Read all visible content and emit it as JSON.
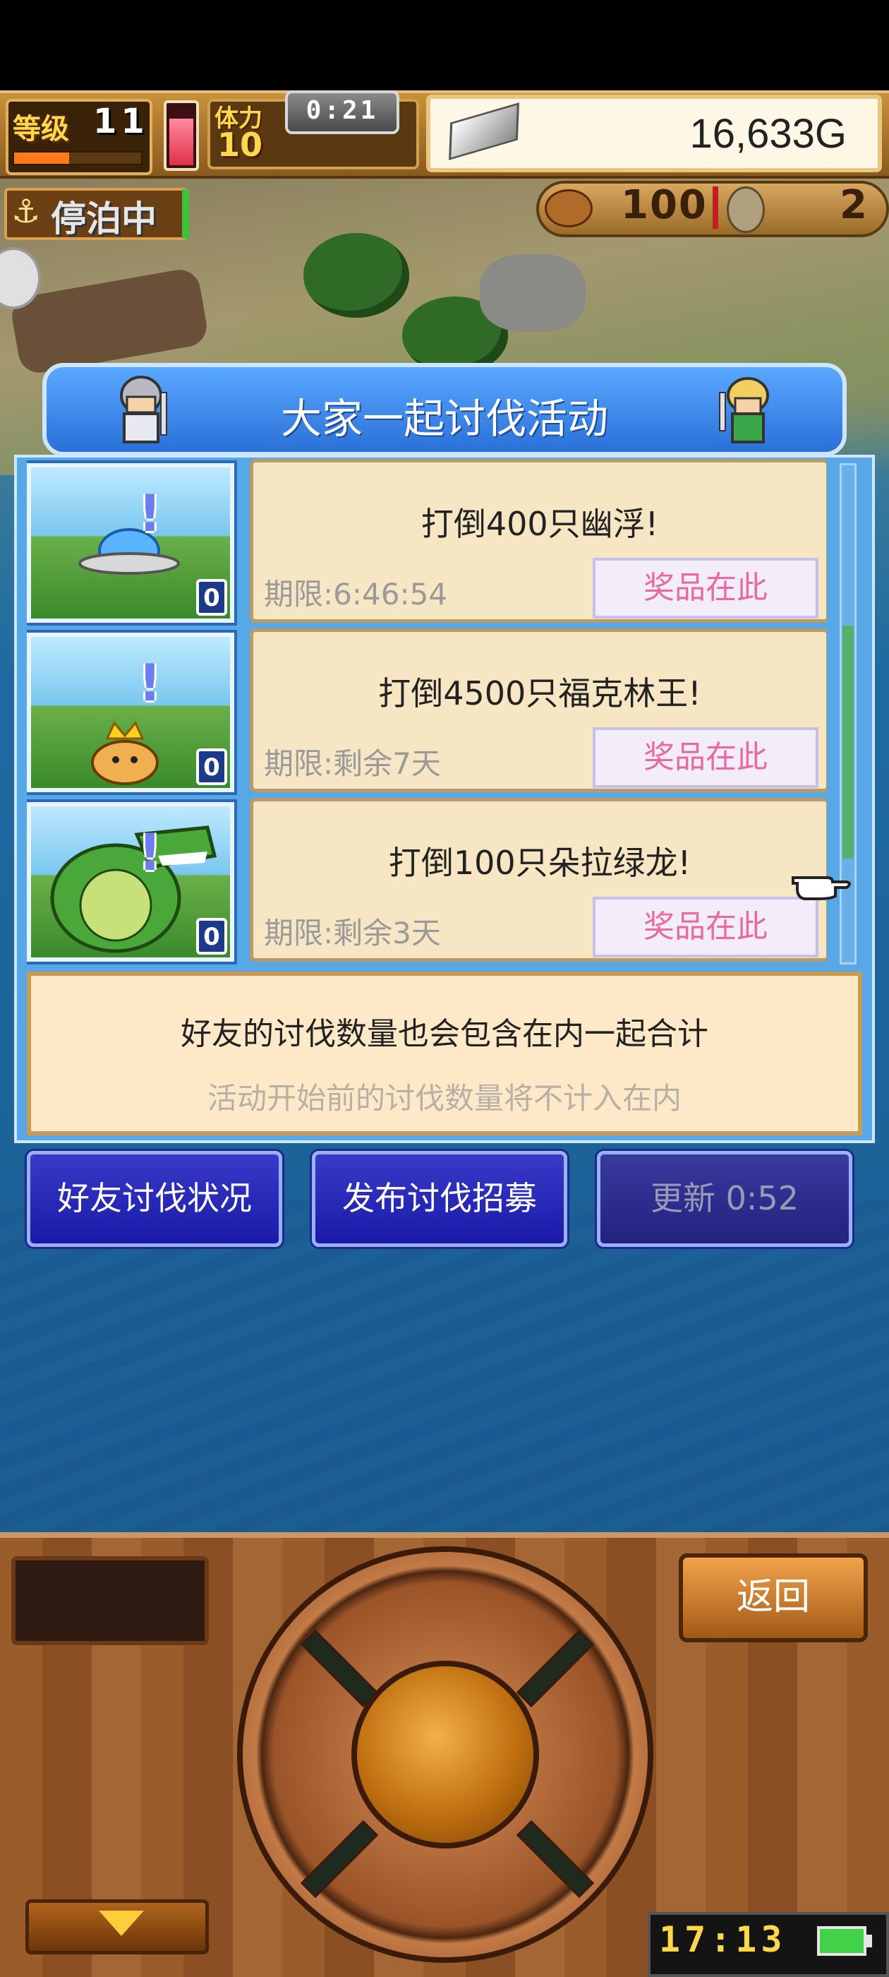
{
  "hud": {
    "level_label": "等级",
    "level": "11",
    "stamina_label": "体力",
    "stamina": "10",
    "timer": "0:21",
    "gold": "16,633G"
  },
  "map": {
    "status": "停泊中",
    "food": "100",
    "coins": "2"
  },
  "event": {
    "title": "大家一起讨伐活动",
    "quests": [
      {
        "title": "打倒400只幽浮!",
        "deadline": "期限:6:46:54",
        "prize_label": "奖品在此",
        "progress": "0",
        "monster": "ufo"
      },
      {
        "title": "打倒4500只福克林王!",
        "deadline": "期限:剩余7天",
        "prize_label": "奖品在此",
        "progress": "0",
        "monster": "crowned-slime"
      },
      {
        "title": "打倒100只朵拉绿龙!",
        "deadline": "期限:剩余3天",
        "prize_label": "奖品在此",
        "progress": "0",
        "monster": "green-dragon"
      }
    ],
    "note_main": "好友的讨伐数量也会包含在内一起合计",
    "note_sub": "活动开始前的讨伐数量将不计入在内"
  },
  "buttons": {
    "friends_status": "好友讨伐状况",
    "recruit": "发布讨伐招募",
    "refresh": "更新 0:52"
  },
  "console": {
    "back": "返回",
    "clock": "17:13"
  },
  "colors": {
    "prize_text": "#e96aa0",
    "panel_blue": "#58a8e8",
    "button_blue": "#1a1aa8"
  }
}
